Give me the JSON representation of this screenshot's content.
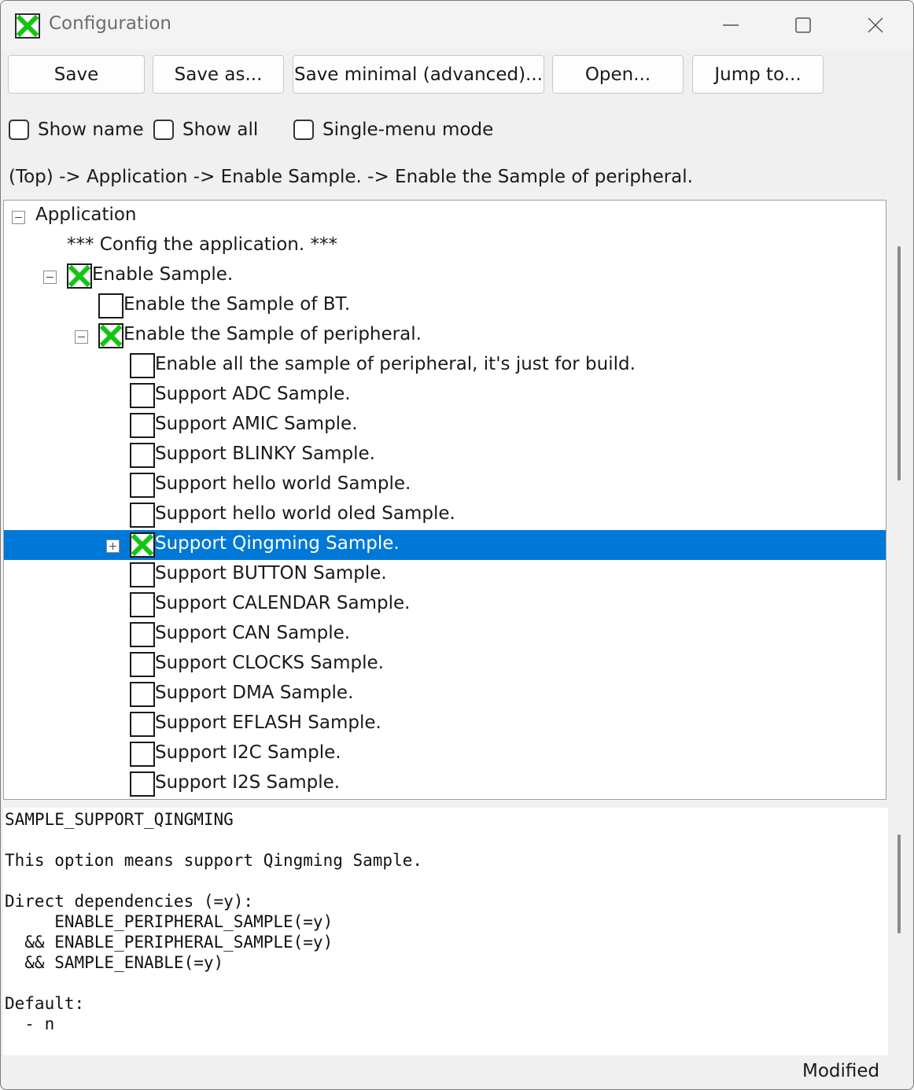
{
  "window": {
    "title": "Configuration",
    "controls": [
      "minimize-icon",
      "maximize-icon",
      "close-icon"
    ]
  },
  "toolbar": {
    "save": "Save",
    "save_as": "Save as...",
    "save_minimal": "Save minimal (advanced)...",
    "open": "Open...",
    "jump_to": "Jump to..."
  },
  "options": {
    "show_name": "Show name",
    "show_all": "Show all",
    "single_menu": "Single-menu mode"
  },
  "path": "(Top) -> Application -> Enable Sample. -> Enable the Sample of peripheral.",
  "tree": {
    "items": [
      {
        "label": "Application",
        "expander": "minus",
        "checkbox": "none"
      },
      {
        "label": "*** Config the application. ***",
        "expander": "none",
        "checkbox": "none"
      },
      {
        "label": "Enable Sample.",
        "expander": "minus",
        "checkbox": "checked"
      },
      {
        "label": "Enable the Sample of BT.",
        "expander": "none",
        "checkbox": "unchecked"
      },
      {
        "label": "Enable the Sample of peripheral.",
        "expander": "minus",
        "checkbox": "checked"
      },
      {
        "label": "Enable all the sample of peripheral, it's just for build.",
        "expander": "none",
        "checkbox": "unchecked"
      },
      {
        "label": "Support ADC Sample.",
        "expander": "none",
        "checkbox": "unchecked"
      },
      {
        "label": "Support AMIC Sample.",
        "expander": "none",
        "checkbox": "unchecked"
      },
      {
        "label": "Support BLINKY Sample.",
        "expander": "none",
        "checkbox": "unchecked"
      },
      {
        "label": "Support hello world Sample.",
        "expander": "none",
        "checkbox": "unchecked"
      },
      {
        "label": "Support hello world oled Sample.",
        "expander": "none",
        "checkbox": "unchecked"
      },
      {
        "label": "Support Qingming Sample.",
        "expander": "plus",
        "checkbox": "checked",
        "selected": true
      },
      {
        "label": "Support BUTTON Sample.",
        "expander": "none",
        "checkbox": "unchecked"
      },
      {
        "label": "Support CALENDAR Sample.",
        "expander": "none",
        "checkbox": "unchecked"
      },
      {
        "label": "Support CAN Sample.",
        "expander": "none",
        "checkbox": "unchecked"
      },
      {
        "label": "Support CLOCKS Sample.",
        "expander": "none",
        "checkbox": "unchecked"
      },
      {
        "label": "Support DMA Sample.",
        "expander": "none",
        "checkbox": "unchecked"
      },
      {
        "label": "Support EFLASH Sample.",
        "expander": "none",
        "checkbox": "unchecked"
      },
      {
        "label": "Support I2C Sample.",
        "expander": "none",
        "checkbox": "unchecked"
      },
      {
        "label": "Support I2S Sample.",
        "expander": "none",
        "checkbox": "unchecked"
      }
    ]
  },
  "info": {
    "text": "SAMPLE_SUPPORT_QINGMING\n\nThis option means support Qingming Sample.\n\nDirect dependencies (=y):\n     ENABLE_PERIPHERAL_SAMPLE(=y)\n  && ENABLE_PERIPHERAL_SAMPLE(=y)\n  && SAMPLE_ENABLE(=y)\n\nDefault:\n  - n"
  },
  "status": "Modified",
  "colors": {
    "selection": "#0078d7",
    "check_green": "#14c414"
  }
}
